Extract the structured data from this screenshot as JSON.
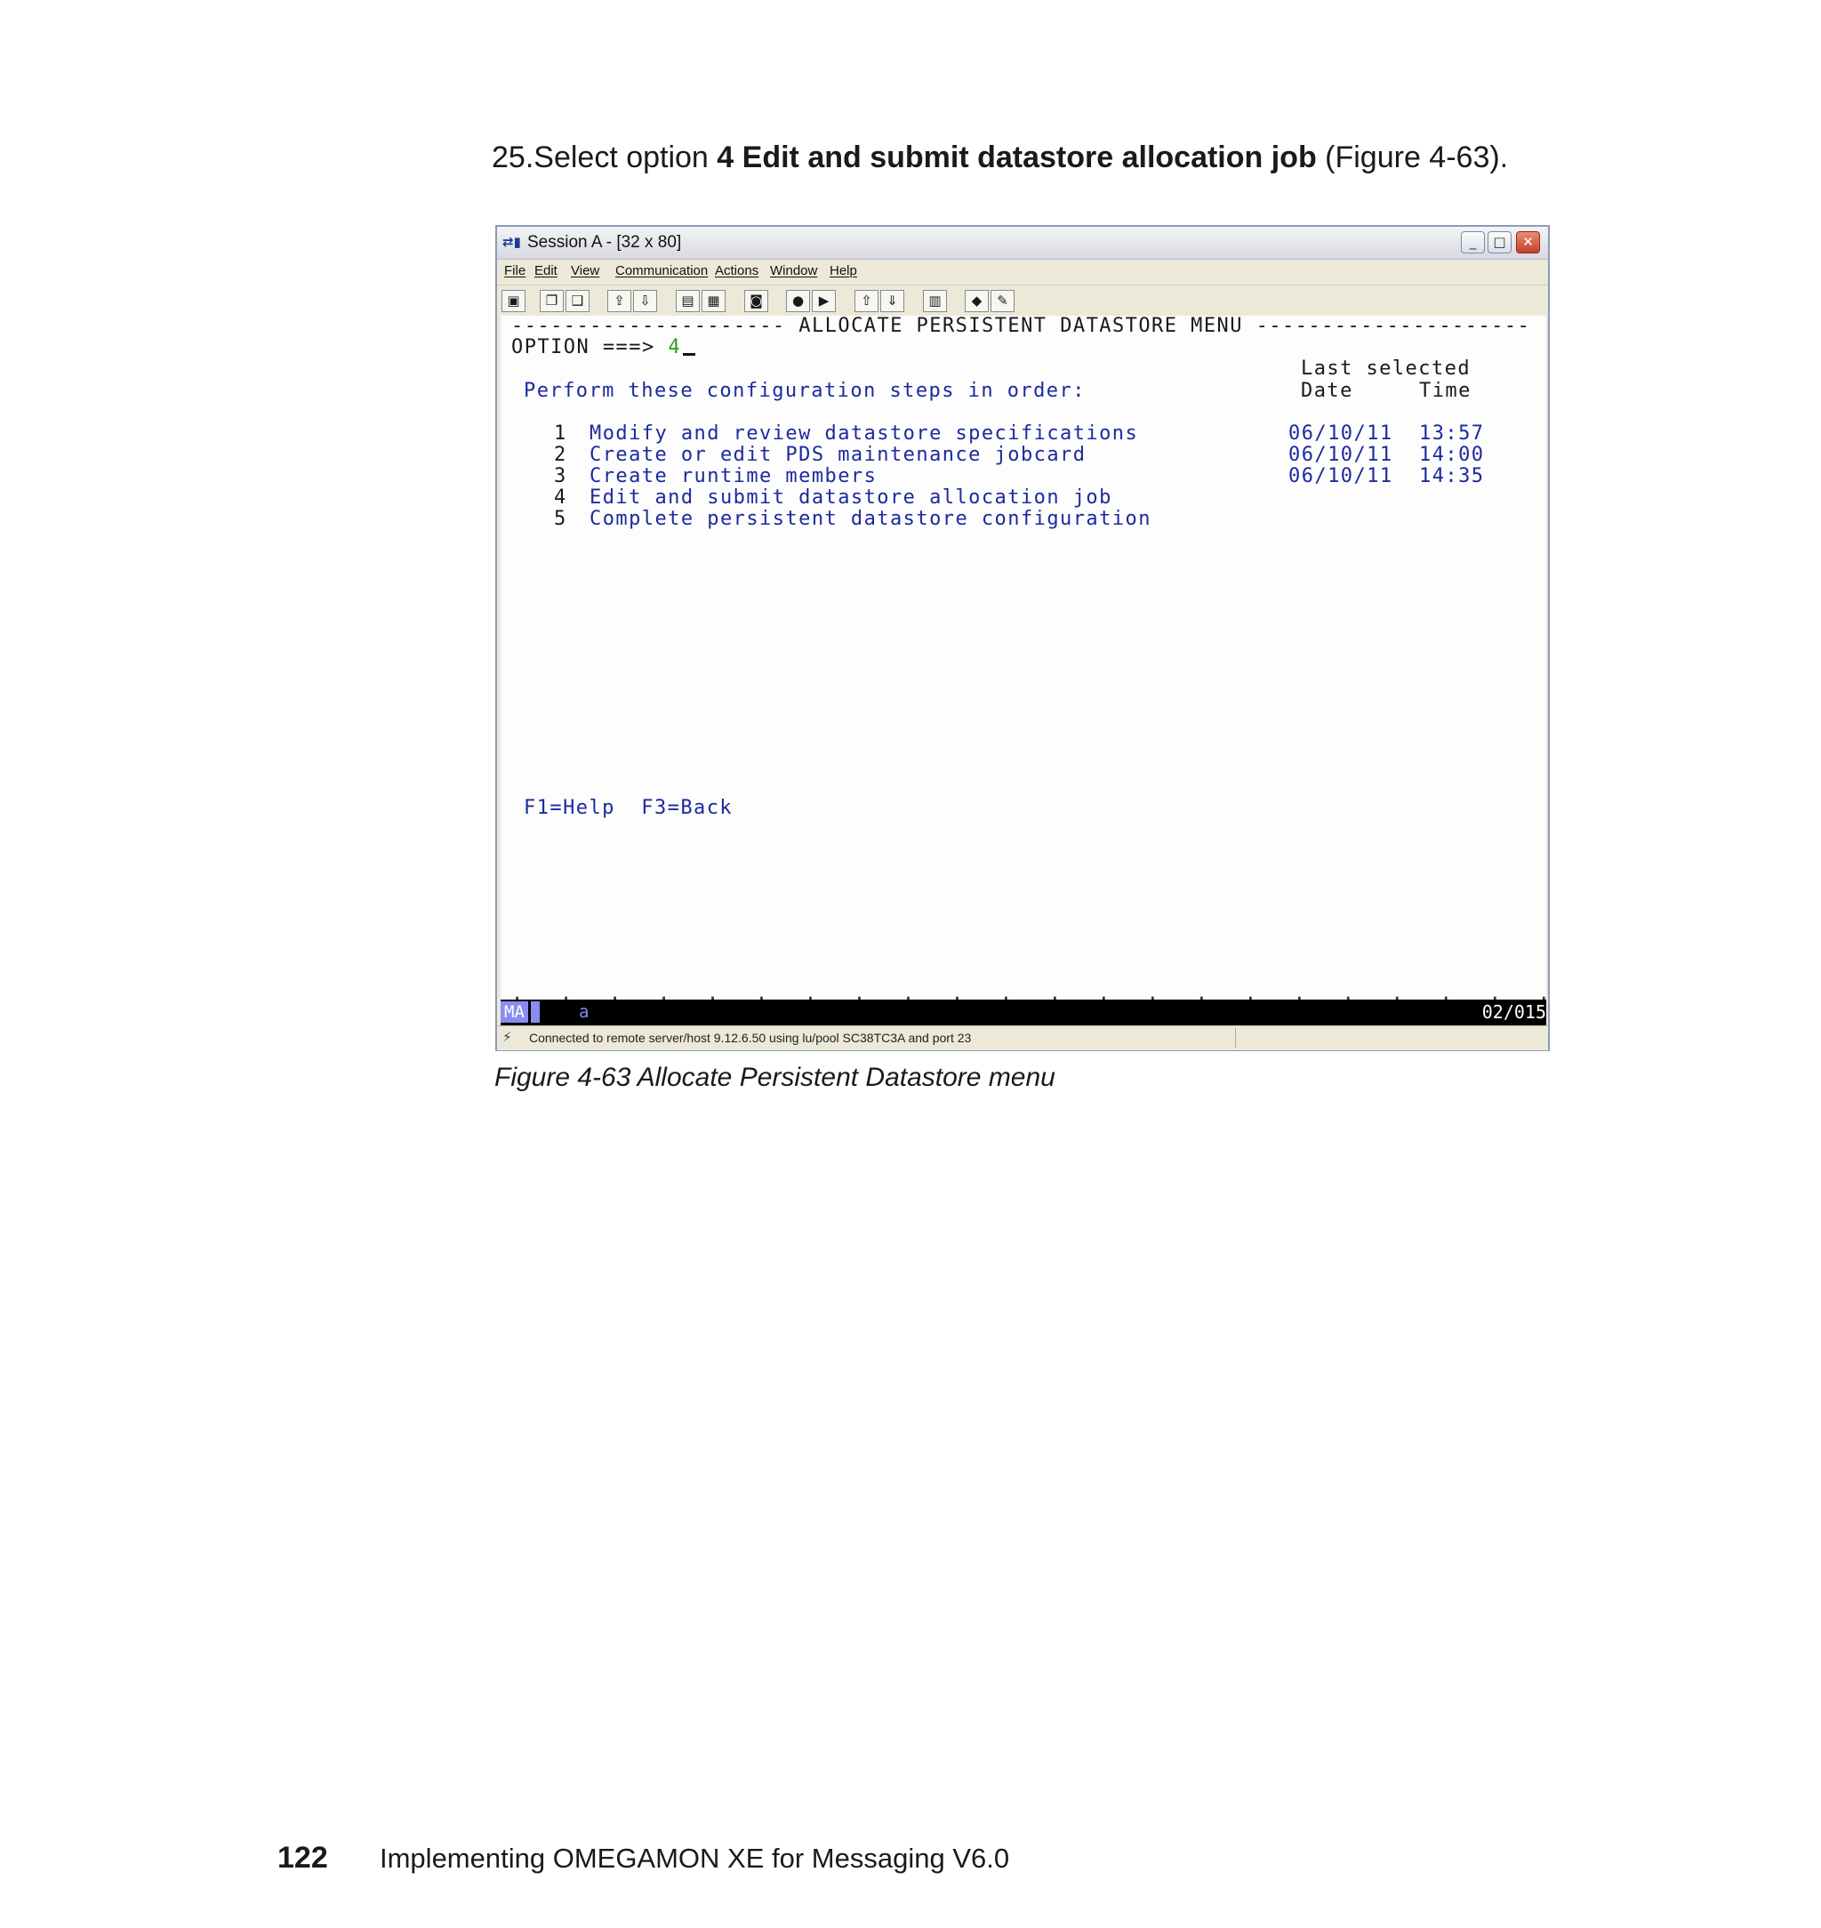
{
  "instruction": {
    "prefix": "25.Select option ",
    "bold": "4 Edit and submit datastore allocation job",
    "suffix": " (Figure 4-63)."
  },
  "window": {
    "title": "Session A - [32 x 80]",
    "menu": [
      "File",
      "Edit",
      "View",
      "Communication",
      "Actions",
      "Window",
      "Help"
    ],
    "controls": {
      "minimize": "_",
      "maximize": "□",
      "close": "✕"
    }
  },
  "toolbar": {
    "icons": [
      "print-screen-icon",
      "copy-icon",
      "paste-icon",
      "send-file-icon",
      "receive-file-icon",
      "display-icon",
      "keyboard-icon",
      "macro-icon",
      "record-macro-icon",
      "play-macro-icon",
      "transfer-up-icon",
      "transfer-down-icon",
      "clipboard-icon",
      "connect-icon",
      "edit-icon"
    ],
    "glyphs": [
      "▣",
      "❐",
      "❑",
      "⇪",
      "⇩",
      "▤",
      "▦",
      "◙",
      "●",
      "▶",
      "⇧",
      "⇓",
      "▥",
      "◆",
      "✎"
    ]
  },
  "terminal": {
    "header": "--------------------- ALLOCATE PERSISTENT DATASTORE MENU ---------------------",
    "option_label": "OPTION ===>",
    "option_value": "4",
    "last_selected_label": "Last selected",
    "instructions": "Perform these configuration steps in order:",
    "date_label": "Date",
    "time_label": "Time",
    "steps": [
      {
        "num": "1",
        "text": "Modify and review datastore specifications",
        "date": "06/10/11",
        "time": "13:57"
      },
      {
        "num": "2",
        "text": "Create or edit PDS maintenance jobcard",
        "date": "06/10/11",
        "time": "14:00"
      },
      {
        "num": "3",
        "text": "Create runtime members",
        "date": "06/10/11",
        "time": "14:35"
      },
      {
        "num": "4",
        "text": "Edit and submit datastore allocation job",
        "date": "",
        "time": ""
      },
      {
        "num": "5",
        "text": "Complete persistent datastore configuration",
        "date": "",
        "time": ""
      }
    ],
    "fkeys": "F1=Help  F3=Back",
    "dots": ".   .   .   .   .   .   .   .   .   .   .   .   .   .   .   .   .   .   .   .   .   .   .   .   .   .   .   ."
  },
  "oia": {
    "mode": "MA",
    "indicator": "a",
    "position": "02/015"
  },
  "status": {
    "icon": "connection-icon",
    "text": "Connected to remote server/host 9.12.6.50 using lu/pool SC38TC3A and port 23"
  },
  "caption": "Figure 4-63   Allocate Persistent Datastore menu",
  "footer": {
    "page": "122",
    "title": "Implementing OMEGAMON XE for Messaging V6.0"
  },
  "colors": {
    "terminal_blue": "#1b2a9e",
    "terminal_green": "#2a9d1f",
    "oia_accent": "#8a8cf2"
  }
}
